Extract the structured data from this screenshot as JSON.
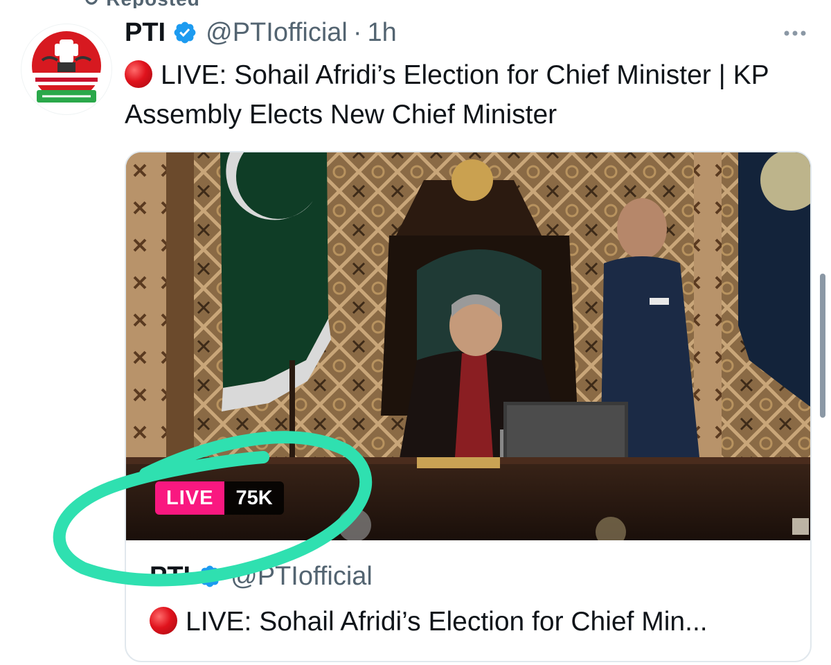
{
  "tweet": {
    "author_name": "PTI",
    "handle": "@PTIofficial",
    "separator": "·",
    "time": "1h",
    "text": "LIVE: Sohail Afridi’s Election for Chief Minister | KP Assembly Elects New Chief Minister",
    "avatar_icon": "pti-logo-icon",
    "verified_icon": "verified-badge-icon",
    "more_icon": "more-options-icon",
    "live_emoji_icon": "red-circle-icon"
  },
  "card": {
    "author_name": "PTI",
    "handle": "@PTIofficial",
    "title": "LIVE: Sohail Afridi’s Election for Chief Min...",
    "live_label": "LIVE",
    "viewers": "75K"
  },
  "colors": {
    "verified": "#1d9bf0",
    "live_pill": "#f91880",
    "annotation": "#2fe0b0",
    "secondary_text": "#536471"
  }
}
